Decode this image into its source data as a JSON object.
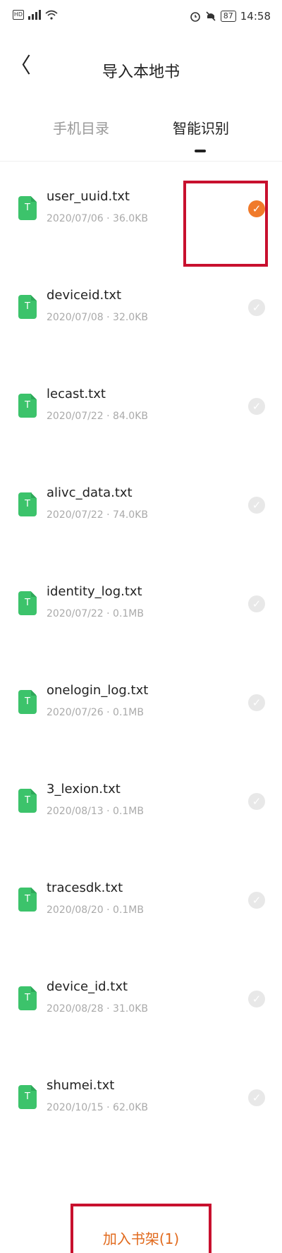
{
  "status_bar": {
    "left_icons": [
      "hd-icon",
      "signal-icon",
      "wifi-icon"
    ],
    "right_icons": [
      "alarm-icon",
      "mute-icon"
    ],
    "battery": "87",
    "time": "14:58"
  },
  "nav": {
    "back_glyph": "〈",
    "title": "导入本地书"
  },
  "tabs": [
    {
      "label": "手机目录",
      "active": false
    },
    {
      "label": "智能识别",
      "active": true
    }
  ],
  "files": [
    {
      "name": "user_uuid.txt",
      "meta": "2020/07/06 · 36.0KB",
      "selected": true
    },
    {
      "name": "deviceid.txt",
      "meta": "2020/07/08 · 32.0KB",
      "selected": false
    },
    {
      "name": "lecast.txt",
      "meta": "2020/07/22 · 84.0KB",
      "selected": false
    },
    {
      "name": "alivc_data.txt",
      "meta": "2020/07/22 · 74.0KB",
      "selected": false
    },
    {
      "name": "identity_log.txt",
      "meta": "2020/07/22 · 0.1MB",
      "selected": false
    },
    {
      "name": "onelogin_log.txt",
      "meta": "2020/07/26 · 0.1MB",
      "selected": false
    },
    {
      "name": "3_lexion.txt",
      "meta": "2020/08/13 · 0.1MB",
      "selected": false
    },
    {
      "name": "tracesdk.txt",
      "meta": "2020/08/20 · 0.1MB",
      "selected": false
    },
    {
      "name": "device_id.txt",
      "meta": "2020/08/28 · 31.0KB",
      "selected": false
    },
    {
      "name": "shumei.txt",
      "meta": "2020/10/15 · 62.0KB",
      "selected": false
    }
  ],
  "file_icon_letter": "T",
  "check_glyph": "✓",
  "bottom_button": "加入书架(1)",
  "colors": {
    "accent": "#f07a2a",
    "file_icon": "#3cc36b",
    "annotation": "#c8102e"
  }
}
